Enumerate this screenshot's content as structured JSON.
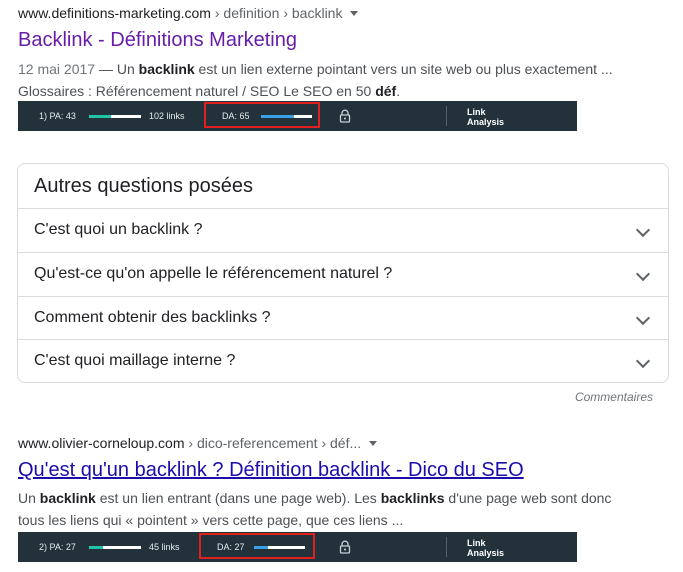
{
  "result1": {
    "domain": "www.definitions-marketing.com",
    "path": " › definition › backlink",
    "title": "Backlink - Définitions Marketing",
    "date": "12 mai 2017",
    "line1_a": " — Un ",
    "line1_b": "backlink",
    "line1_c": " est un lien externe pointant vers un site web ou plus exactement ...",
    "line2_a": "Glossaires : Référencement naturel / SEO Le SEO en 50 ",
    "line2_b": "déf",
    "line2_c": "."
  },
  "moz1": {
    "pa": "1) PA: 43",
    "pa_value": 43,
    "links": "102 links",
    "da": "DA: 65",
    "da_value": 65,
    "link_analysis_1": "Link",
    "link_analysis_2": "Analysis"
  },
  "paa": {
    "title": "Autres questions posées",
    "questions": [
      "C'est quoi un backlink ?",
      "Qu'est-ce qu'on appelle le référencement naturel ?",
      "Comment obtenir des backlinks ?",
      "C'est quoi maillage interne ?"
    ],
    "comments": "Commentaires"
  },
  "result2": {
    "domain": "www.olivier-corneloup.com",
    "path": " › dico-referencement › déf...",
    "title": "Qu'est qu'un backlink ? Définition backlink - Dico du SEO",
    "line1_a": "Un ",
    "line1_b": "backlink",
    "line1_c": " est un lien entrant (dans une page web). Les ",
    "line1_d": "backlinks",
    "line1_e": " d'une page web sont donc",
    "line2": "tous les liens qui « pointent » vers cette page, que ces liens ..."
  },
  "moz2": {
    "pa": "2) PA: 27",
    "pa_value": 27,
    "links": "45 links",
    "da": "DA: 27",
    "da_value": 27,
    "link_analysis_1": "Link",
    "link_analysis_2": "Analysis"
  },
  "colors": {
    "visited": "#681da8",
    "link": "#1a0dab",
    "moz_bg": "#22313a",
    "pa_fill": "#1fc3a6",
    "da_fill": "#3aa0e8",
    "highlight": "#e0201e"
  }
}
